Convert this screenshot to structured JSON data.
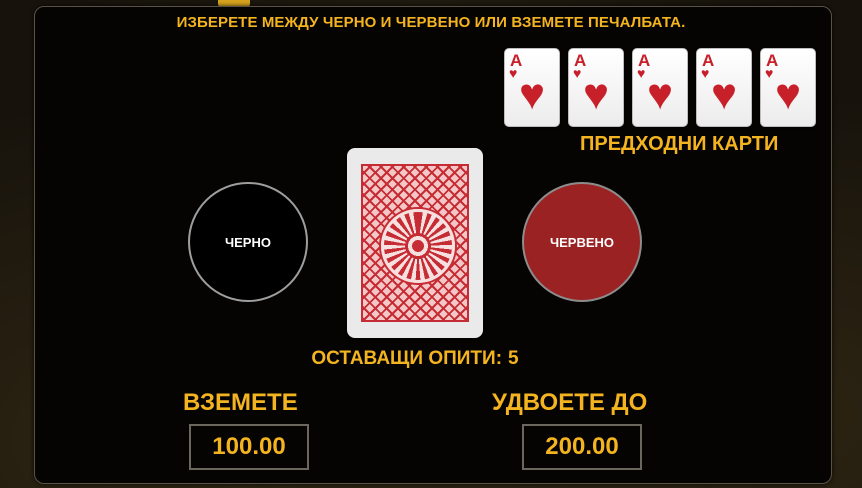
{
  "instruction": "ИЗБЕРЕТЕ МЕЖДУ ЧЕРНО И ЧЕРВЕНО ИЛИ ВЗЕМЕТЕ ПЕЧАЛБАТА.",
  "previous_cards": {
    "label": "ПРЕДХОДНИ КАРТИ",
    "cards": [
      {
        "rank": "A",
        "suit": "♥"
      },
      {
        "rank": "A",
        "suit": "♥"
      },
      {
        "rank": "A",
        "suit": "♥"
      },
      {
        "rank": "A",
        "suit": "♥"
      },
      {
        "rank": "A",
        "suit": "♥"
      }
    ]
  },
  "buttons": {
    "black": "ЧЕРНО",
    "red": "ЧЕРВЕНО"
  },
  "tries": {
    "label": "ОСТАВАЩИ ОПИТИ:",
    "value": "5"
  },
  "collect": {
    "label": "ВЗЕМЕТЕ",
    "amount": "100.00"
  },
  "double": {
    "label": "УДВОЕТЕ ДО",
    "amount": "200.00"
  },
  "colors": {
    "accent": "#f4b41f",
    "red_button": "#9b2222",
    "card_back": "#c62c33"
  }
}
